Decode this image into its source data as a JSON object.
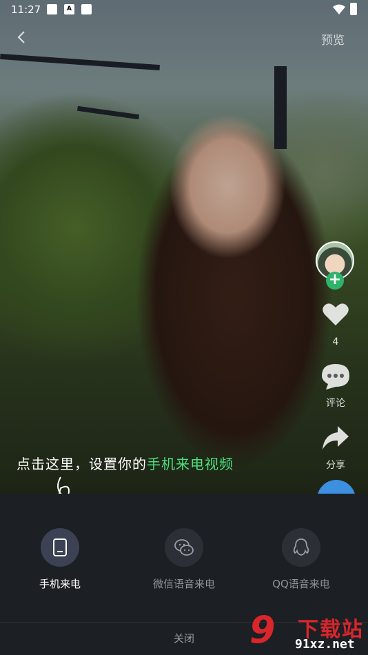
{
  "status_bar": {
    "time": "11:27",
    "notification_letter": "A"
  },
  "top_bar": {
    "preview": "预览"
  },
  "rail": {
    "like_count": "4",
    "comment_label": "评论",
    "share_label": "分享"
  },
  "hint": {
    "prefix": "点击这里，设置你的",
    "highlight": "手机来电视频"
  },
  "sheet": {
    "options": [
      {
        "label": "手机来电",
        "icon": "phone-icon",
        "active": true
      },
      {
        "label": "微信语音来电",
        "icon": "wechat-icon",
        "active": false
      },
      {
        "label": "QQ语音来电",
        "icon": "qq-icon",
        "active": false
      }
    ],
    "close": "关闭"
  },
  "watermark": {
    "brand": "下载站",
    "url": "91xz.net",
    "number": "9"
  },
  "colors": {
    "accent_green": "#4ee07e",
    "sheet_bg": "#1c1f24",
    "follow_green": "#2fb36b",
    "watermark_red": "#d8262b"
  }
}
